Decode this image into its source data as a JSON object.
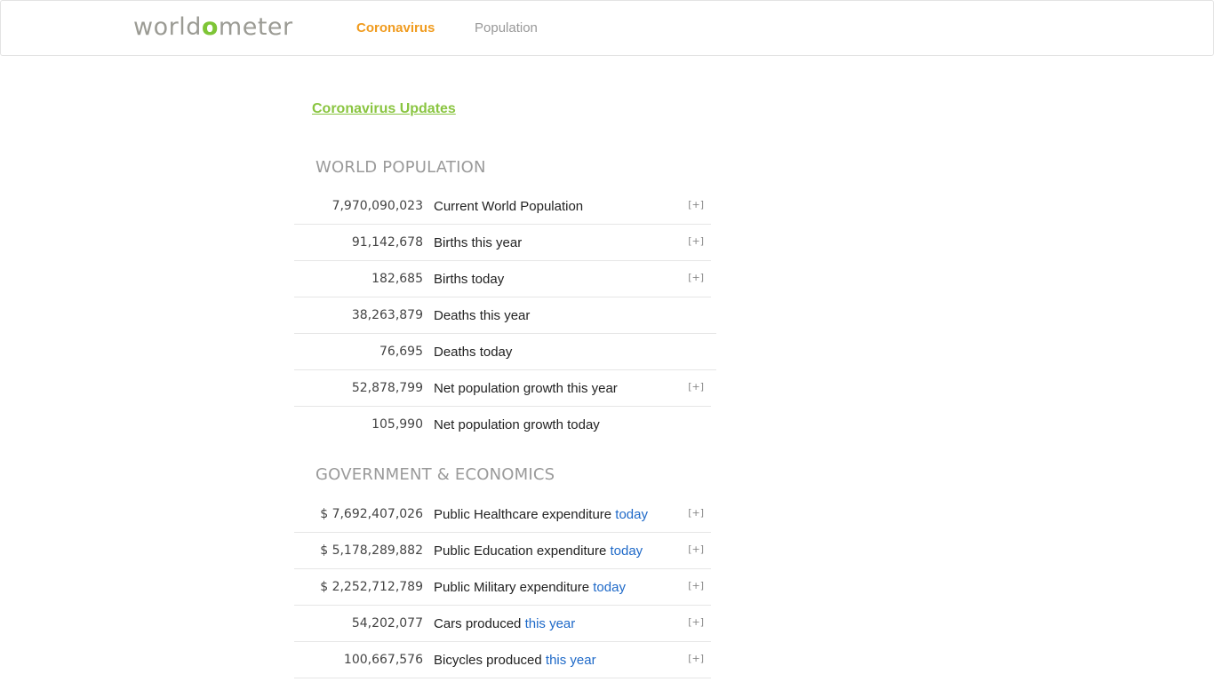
{
  "header": {
    "logo_pre": "world",
    "logo_o": "o",
    "logo_post": "meter",
    "nav": {
      "coronavirus": "Coronavirus",
      "population": "Population"
    }
  },
  "updates_link": "Coronavirus Updates",
  "world_population": {
    "title": "WORLD POPULATION",
    "rows": [
      {
        "value": "7,970,090,023",
        "label": "Current World Population",
        "suffix": "",
        "expand": "[+]"
      },
      {
        "value": "91,142,678",
        "label": "Births this year",
        "suffix": "",
        "expand": "[+]"
      },
      {
        "value": "182,685",
        "label": "Births today",
        "suffix": "",
        "expand": "[+]"
      },
      {
        "value": "38,263,879",
        "label": "Deaths this year",
        "suffix": "",
        "expand": ""
      },
      {
        "value": "76,695",
        "label": "Deaths today",
        "suffix": "",
        "expand": ""
      },
      {
        "value": "52,878,799",
        "label": "Net population growth this year",
        "suffix": "",
        "expand": "[+]"
      },
      {
        "value": "105,990",
        "label": "Net population growth today",
        "suffix": "",
        "expand": ""
      }
    ]
  },
  "government_economics": {
    "title": "GOVERNMENT & ECONOMICS",
    "rows": [
      {
        "value": "$ 7,692,407,026",
        "label": "Public Healthcare expenditure ",
        "suffix": "today",
        "expand": "[+]"
      },
      {
        "value": "$ 5,178,289,882",
        "label": "Public Education expenditure ",
        "suffix": "today",
        "expand": "[+]"
      },
      {
        "value": "$ 2,252,712,789",
        "label": "Public Military expenditure ",
        "suffix": "today",
        "expand": "[+]"
      },
      {
        "value": "54,202,077",
        "label": "Cars produced ",
        "suffix": "this year",
        "expand": "[+]"
      },
      {
        "value": "100,667,576",
        "label": "Bicycles produced ",
        "suffix": "this year",
        "expand": "[+]"
      }
    ]
  },
  "colors": {
    "accent_orange": "#f09b1e",
    "accent_green": "#8ac541",
    "link_blue": "#1e69c8"
  }
}
